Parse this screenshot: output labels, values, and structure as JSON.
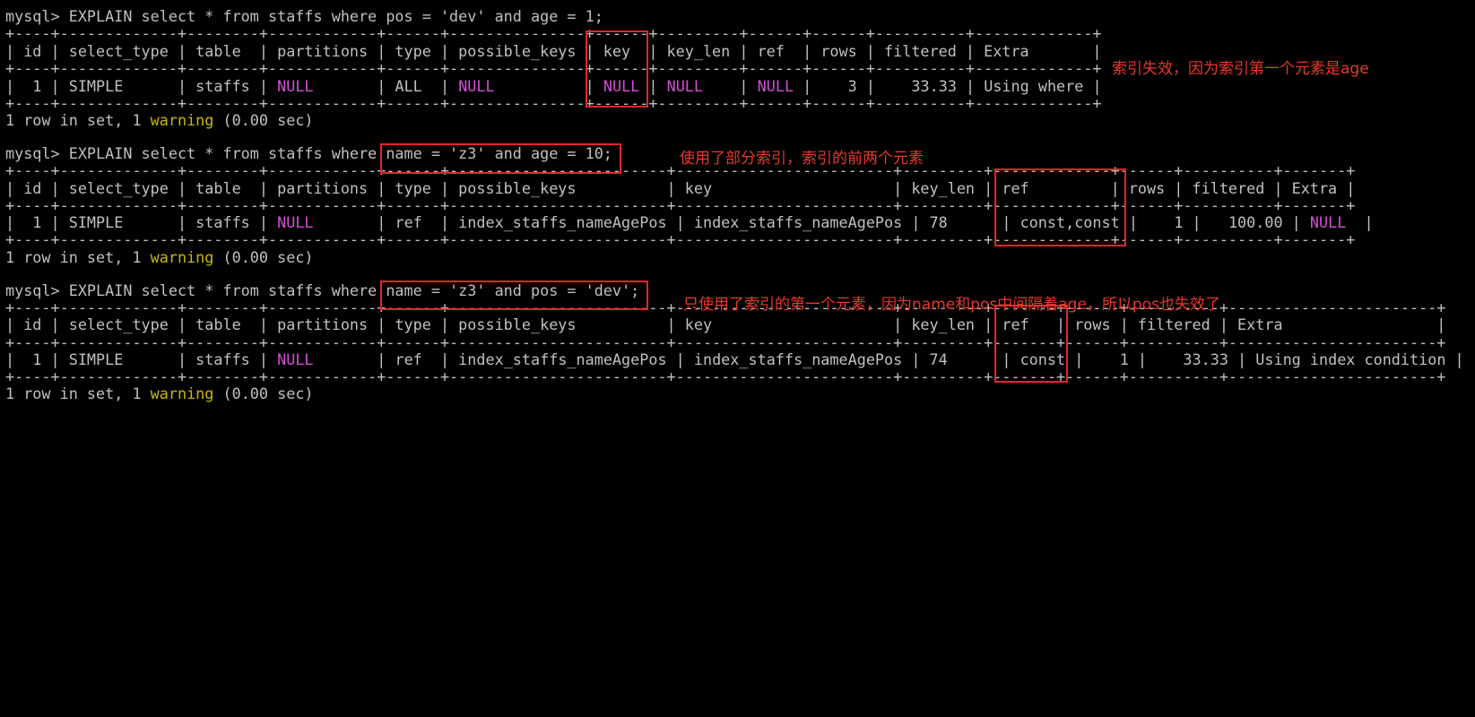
{
  "colors": {
    "background": "#000000",
    "text": "#c0c0c0",
    "null_keyword": "#d44fd4",
    "warning_keyword": "#c9b800",
    "annotation": "#e8392a"
  },
  "query1": {
    "command": "mysql> EXPLAIN select * from staffs where pos = 'dev' and age = 1;",
    "border": "+----+-------------+--------+------------+------+---------------+------+---------+------+------+----------+-------------+",
    "header": "| id | select_type | table  | partitions | type | possible_keys | key  | key_len | ref  | rows | filtered | Extra       |",
    "row": [
      {
        "t": "|  1 | SIMPLE      | staffs | "
      },
      {
        "t": "NULL",
        "c": "null"
      },
      {
        "t": "       | ALL  | "
      },
      {
        "t": "NULL",
        "c": "null"
      },
      {
        "t": "          | "
      },
      {
        "t": "NULL",
        "c": "null"
      },
      {
        "t": " | "
      },
      {
        "t": "NULL",
        "c": "null"
      },
      {
        "t": "    | "
      },
      {
        "t": "NULL",
        "c": "null"
      },
      {
        "t": " |    3 |    33.33 | Using where |"
      }
    ],
    "result_pre": "1 row in set, 1 ",
    "result_warning": "warning",
    "result_post": " (0.00 sec)",
    "annotation": "索引失效，因为索引第一个元素是age"
  },
  "query2": {
    "command": "mysql> EXPLAIN select * from staffs where name = 'z3' and age = 10;",
    "border": "+----+-------------+--------+------------+------+------------------------+------------------------+---------+-------------+------+----------+-------+",
    "header": "| id | select_type | table  | partitions | type | possible_keys          | key                    | key_len | ref         | rows | filtered | Extra |",
    "row": [
      {
        "t": "|  1 | SIMPLE      | staffs | "
      },
      {
        "t": "NULL",
        "c": "null"
      },
      {
        "t": "       | ref  | index_staffs_nameAgePos | index_staffs_nameAgePos | 78      | const,const |    1 |   100.00 | "
      },
      {
        "t": "NULL",
        "c": "null"
      },
      {
        "t": "  |"
      }
    ],
    "result_pre": "1 row in set, 1 ",
    "result_warning": "warning",
    "result_post": " (0.00 sec)",
    "annotation": "使用了部分索引，索引的前两个元素"
  },
  "query3": {
    "command": "mysql> EXPLAIN select * from staffs where name = 'z3' and pos = 'dev';",
    "border": "+----+-------------+--------+------------+------+------------------------+------------------------+---------+-------+------+----------+-----------------------+",
    "header": "| id | select_type | table  | partitions | type | possible_keys          | key                    | key_len | ref   | rows | filtered | Extra                 |",
    "row": [
      {
        "t": "|  1 | SIMPLE      | staffs | "
      },
      {
        "t": "NULL",
        "c": "null"
      },
      {
        "t": "       | ref  | index_staffs_nameAgePos | index_staffs_nameAgePos | 74      | const |    1 |    33.33 | Using index condition |"
      }
    ],
    "result_pre": "1 row in set, 1 ",
    "result_warning": "warning",
    "result_post": " (0.00 sec)",
    "annotation": "只使用了索引的第一个元素，因为name和pos中间隔着age，所以pos也失效了"
  }
}
